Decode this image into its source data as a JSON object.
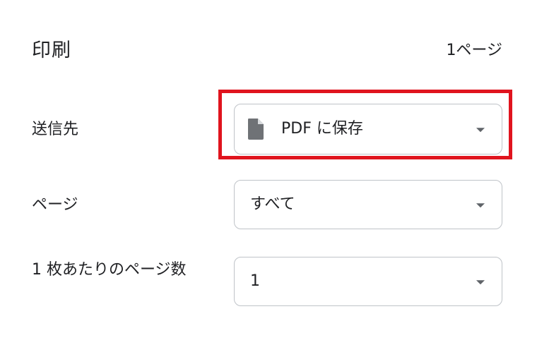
{
  "header": {
    "title": "印刷",
    "page_count": "1ページ"
  },
  "destination": {
    "label": "送信先",
    "value": "PDF に保存",
    "icon": "file-icon"
  },
  "pages": {
    "label": "ページ",
    "value": "すべて"
  },
  "pages_per_sheet": {
    "label": "1 枚あたりのページ数",
    "value": "1"
  },
  "colors": {
    "highlight": "#e0141e",
    "text": "#202124",
    "border": "#bfc3c8",
    "icon": "#6f7276"
  }
}
